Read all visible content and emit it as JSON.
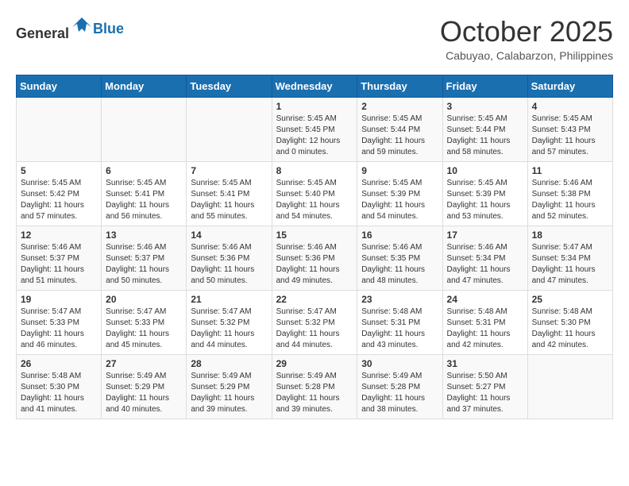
{
  "header": {
    "logo": {
      "text_general": "General",
      "text_blue": "Blue"
    },
    "month": "October 2025",
    "location": "Cabuyao, Calabarzon, Philippines"
  },
  "weekdays": [
    "Sunday",
    "Monday",
    "Tuesday",
    "Wednesday",
    "Thursday",
    "Friday",
    "Saturday"
  ],
  "weeks": [
    [
      {
        "day": "",
        "sunrise": "",
        "sunset": "",
        "daylight": ""
      },
      {
        "day": "",
        "sunrise": "",
        "sunset": "",
        "daylight": ""
      },
      {
        "day": "",
        "sunrise": "",
        "sunset": "",
        "daylight": ""
      },
      {
        "day": "1",
        "sunrise": "Sunrise: 5:45 AM",
        "sunset": "Sunset: 5:45 PM",
        "daylight": "Daylight: 12 hours and 0 minutes."
      },
      {
        "day": "2",
        "sunrise": "Sunrise: 5:45 AM",
        "sunset": "Sunset: 5:44 PM",
        "daylight": "Daylight: 11 hours and 59 minutes."
      },
      {
        "day": "3",
        "sunrise": "Sunrise: 5:45 AM",
        "sunset": "Sunset: 5:44 PM",
        "daylight": "Daylight: 11 hours and 58 minutes."
      },
      {
        "day": "4",
        "sunrise": "Sunrise: 5:45 AM",
        "sunset": "Sunset: 5:43 PM",
        "daylight": "Daylight: 11 hours and 57 minutes."
      }
    ],
    [
      {
        "day": "5",
        "sunrise": "Sunrise: 5:45 AM",
        "sunset": "Sunset: 5:42 PM",
        "daylight": "Daylight: 11 hours and 57 minutes."
      },
      {
        "day": "6",
        "sunrise": "Sunrise: 5:45 AM",
        "sunset": "Sunset: 5:41 PM",
        "daylight": "Daylight: 11 hours and 56 minutes."
      },
      {
        "day": "7",
        "sunrise": "Sunrise: 5:45 AM",
        "sunset": "Sunset: 5:41 PM",
        "daylight": "Daylight: 11 hours and 55 minutes."
      },
      {
        "day": "8",
        "sunrise": "Sunrise: 5:45 AM",
        "sunset": "Sunset: 5:40 PM",
        "daylight": "Daylight: 11 hours and 54 minutes."
      },
      {
        "day": "9",
        "sunrise": "Sunrise: 5:45 AM",
        "sunset": "Sunset: 5:39 PM",
        "daylight": "Daylight: 11 hours and 54 minutes."
      },
      {
        "day": "10",
        "sunrise": "Sunrise: 5:45 AM",
        "sunset": "Sunset: 5:39 PM",
        "daylight": "Daylight: 11 hours and 53 minutes."
      },
      {
        "day": "11",
        "sunrise": "Sunrise: 5:46 AM",
        "sunset": "Sunset: 5:38 PM",
        "daylight": "Daylight: 11 hours and 52 minutes."
      }
    ],
    [
      {
        "day": "12",
        "sunrise": "Sunrise: 5:46 AM",
        "sunset": "Sunset: 5:37 PM",
        "daylight": "Daylight: 11 hours and 51 minutes."
      },
      {
        "day": "13",
        "sunrise": "Sunrise: 5:46 AM",
        "sunset": "Sunset: 5:37 PM",
        "daylight": "Daylight: 11 hours and 50 minutes."
      },
      {
        "day": "14",
        "sunrise": "Sunrise: 5:46 AM",
        "sunset": "Sunset: 5:36 PM",
        "daylight": "Daylight: 11 hours and 50 minutes."
      },
      {
        "day": "15",
        "sunrise": "Sunrise: 5:46 AM",
        "sunset": "Sunset: 5:36 PM",
        "daylight": "Daylight: 11 hours and 49 minutes."
      },
      {
        "day": "16",
        "sunrise": "Sunrise: 5:46 AM",
        "sunset": "Sunset: 5:35 PM",
        "daylight": "Daylight: 11 hours and 48 minutes."
      },
      {
        "day": "17",
        "sunrise": "Sunrise: 5:46 AM",
        "sunset": "Sunset: 5:34 PM",
        "daylight": "Daylight: 11 hours and 47 minutes."
      },
      {
        "day": "18",
        "sunrise": "Sunrise: 5:47 AM",
        "sunset": "Sunset: 5:34 PM",
        "daylight": "Daylight: 11 hours and 47 minutes."
      }
    ],
    [
      {
        "day": "19",
        "sunrise": "Sunrise: 5:47 AM",
        "sunset": "Sunset: 5:33 PM",
        "daylight": "Daylight: 11 hours and 46 minutes."
      },
      {
        "day": "20",
        "sunrise": "Sunrise: 5:47 AM",
        "sunset": "Sunset: 5:33 PM",
        "daylight": "Daylight: 11 hours and 45 minutes."
      },
      {
        "day": "21",
        "sunrise": "Sunrise: 5:47 AM",
        "sunset": "Sunset: 5:32 PM",
        "daylight": "Daylight: 11 hours and 44 minutes."
      },
      {
        "day": "22",
        "sunrise": "Sunrise: 5:47 AM",
        "sunset": "Sunset: 5:32 PM",
        "daylight": "Daylight: 11 hours and 44 minutes."
      },
      {
        "day": "23",
        "sunrise": "Sunrise: 5:48 AM",
        "sunset": "Sunset: 5:31 PM",
        "daylight": "Daylight: 11 hours and 43 minutes."
      },
      {
        "day": "24",
        "sunrise": "Sunrise: 5:48 AM",
        "sunset": "Sunset: 5:31 PM",
        "daylight": "Daylight: 11 hours and 42 minutes."
      },
      {
        "day": "25",
        "sunrise": "Sunrise: 5:48 AM",
        "sunset": "Sunset: 5:30 PM",
        "daylight": "Daylight: 11 hours and 42 minutes."
      }
    ],
    [
      {
        "day": "26",
        "sunrise": "Sunrise: 5:48 AM",
        "sunset": "Sunset: 5:30 PM",
        "daylight": "Daylight: 11 hours and 41 minutes."
      },
      {
        "day": "27",
        "sunrise": "Sunrise: 5:49 AM",
        "sunset": "Sunset: 5:29 PM",
        "daylight": "Daylight: 11 hours and 40 minutes."
      },
      {
        "day": "28",
        "sunrise": "Sunrise: 5:49 AM",
        "sunset": "Sunset: 5:29 PM",
        "daylight": "Daylight: 11 hours and 39 minutes."
      },
      {
        "day": "29",
        "sunrise": "Sunrise: 5:49 AM",
        "sunset": "Sunset: 5:28 PM",
        "daylight": "Daylight: 11 hours and 39 minutes."
      },
      {
        "day": "30",
        "sunrise": "Sunrise: 5:49 AM",
        "sunset": "Sunset: 5:28 PM",
        "daylight": "Daylight: 11 hours and 38 minutes."
      },
      {
        "day": "31",
        "sunrise": "Sunrise: 5:50 AM",
        "sunset": "Sunset: 5:27 PM",
        "daylight": "Daylight: 11 hours and 37 minutes."
      },
      {
        "day": "",
        "sunrise": "",
        "sunset": "",
        "daylight": ""
      }
    ]
  ]
}
